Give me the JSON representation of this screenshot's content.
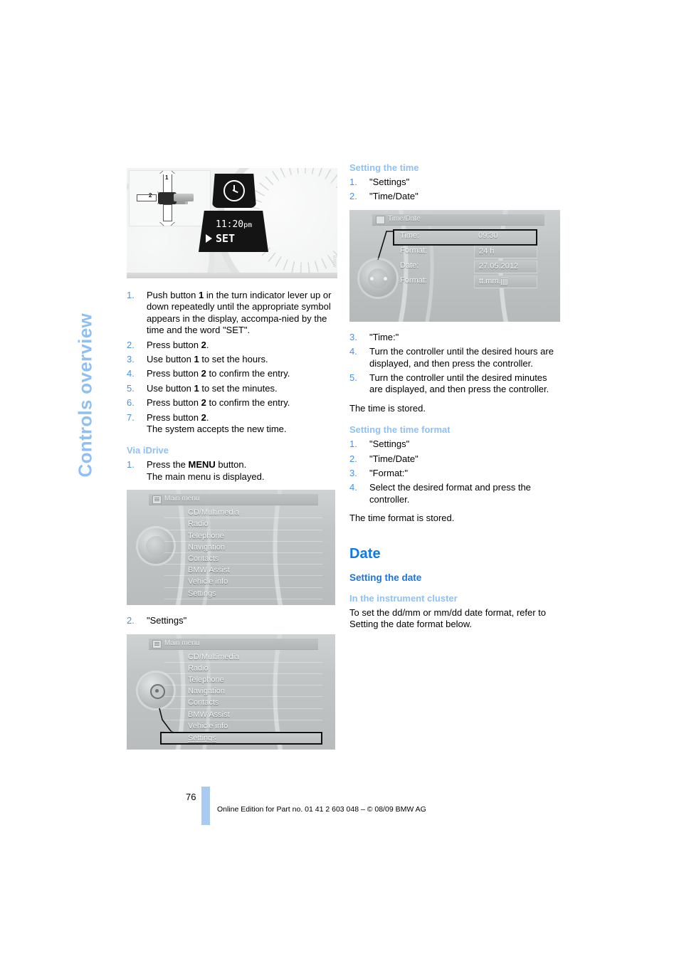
{
  "page": {
    "number": "76",
    "side_tab": "Controls overview",
    "footnote": "Online Edition for Part no. 01 41 2 603 048 – © 08/09 BMW AG"
  },
  "left_column": {
    "cluster_figure": {
      "label_1": "1",
      "label_2": "2",
      "lcd_time": "11:20",
      "lcd_meridiem": "pm",
      "lcd_set": "SET",
      "clock_icon": "clock-icon"
    },
    "steps_cluster": [
      "Push button 1 in the turn indicator lever up or down repeatedly until the appropriate symbol appears in the display, accompanied by the time and the word \"SET\".",
      "Press button 2.",
      "Use button 1 to set the hours.",
      "Press button 2 to confirm the entry.",
      "Use button 1 to set the minutes.",
      "Press button 2 to confirm the entry.",
      "Press button 2.\nThe system accepts the new time."
    ],
    "via_idrive_heading": "Via iDrive",
    "idrive_step1": "Press the MENU button.",
    "idrive_step1_note": "The main menu is displayed.",
    "idrive_step2": "\"Settings\"",
    "main_menu_1": {
      "title": "Main menu",
      "items": [
        "CD/Multimedia",
        "Radio",
        "Telephone",
        "Navigation",
        "Contacts",
        "BMW Assist",
        "Vehicle info",
        "Settings"
      ],
      "selected": ""
    },
    "main_menu_2": {
      "title": "Main menu",
      "items": [
        "CD/Multimedia",
        "Radio",
        "Telephone",
        "Navigation",
        "Contacts",
        "BMW Assist",
        "Vehicle info",
        "Settings"
      ],
      "selected": "Settings"
    }
  },
  "right_column": {
    "setting_time_heading": "Setting the time",
    "setting_time_steps_a": [
      "\"Settings\"",
      "\"Time/Date\""
    ],
    "time_date_screen": {
      "title": "Time/Date",
      "rows": [
        {
          "label": "Time:",
          "value": "09:30",
          "selected": true
        },
        {
          "label": "Format:",
          "value": "24 h",
          "selected": false
        },
        {
          "label": "Date:",
          "value": "27.05.2012",
          "selected": false
        },
        {
          "label": "Format:",
          "value": "tt.mm.jjjj",
          "selected": false
        }
      ]
    },
    "setting_time_steps_b": [
      "\"Time:\"",
      "Turn the controller until the desired hours are displayed, and then press the controller.",
      "Turn the controller until the desired minutes are displayed, and then press the controller."
    ],
    "time_stored_note": "The time is stored.",
    "time_format_heading": "Setting the time format",
    "time_format_steps": [
      "\"Settings\"",
      "\"Time/Date\"",
      "\"Format:\"",
      "Select the desired format and press the controller."
    ],
    "time_format_note": "The time format is stored.",
    "date_heading": "Date",
    "setting_date_heading": "Setting the date",
    "instrument_cluster_heading": "In the instrument cluster",
    "instrument_cluster_text": "To set the dd/mm or mm/dd date format, refer to Setting the date format below."
  },
  "colors": {
    "accent_strong": "#1177EE",
    "accent_medium": "#1A73E8",
    "accent_light": "#8FC0F5",
    "step_number": "#4A90E2",
    "page_bar": "#A9CBF2"
  }
}
